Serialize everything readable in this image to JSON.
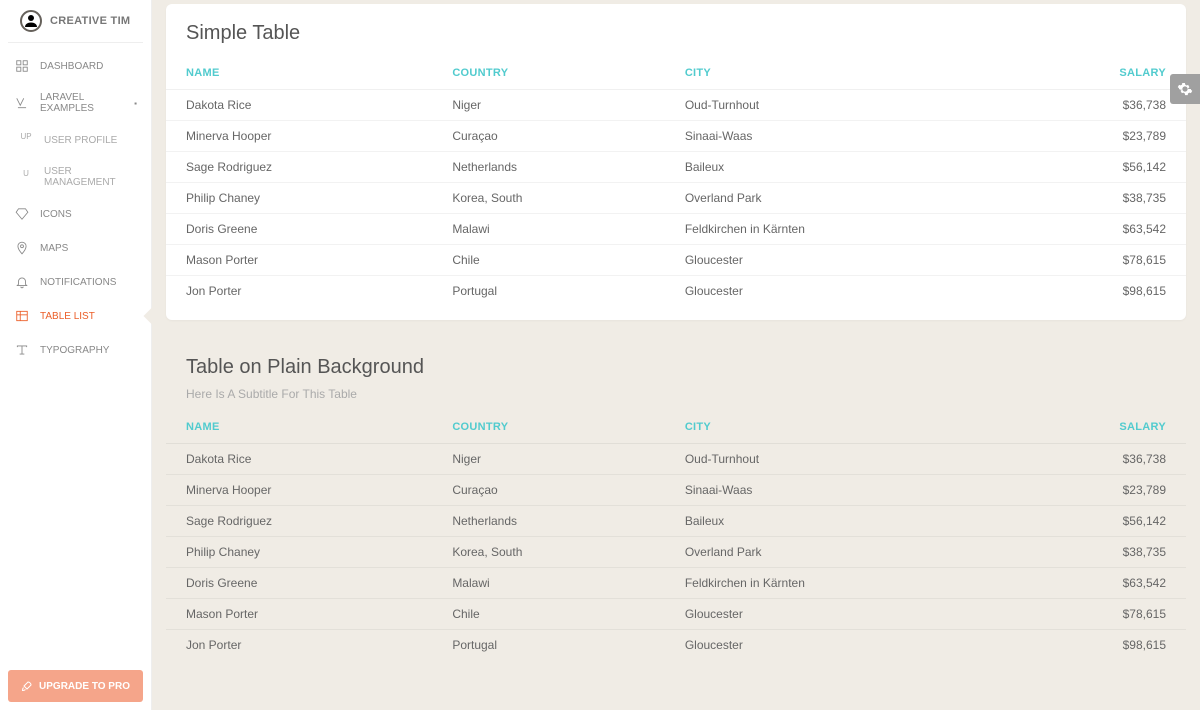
{
  "brand": {
    "name": "CREATIVE TIM"
  },
  "sidebar": {
    "items": [
      {
        "label": "DASHBOARD",
        "icon": "dashboard"
      },
      {
        "label": "LARAVEL EXAMPLES",
        "icon": "laravel",
        "caret": "▪"
      },
      {
        "label": "USER PROFILE",
        "prefix": "UP",
        "sub": true
      },
      {
        "label": "USER MANAGEMENT",
        "prefix": "U",
        "sub": true
      },
      {
        "label": "ICONS",
        "icon": "diamond"
      },
      {
        "label": "MAPS",
        "icon": "pin"
      },
      {
        "label": "NOTIFICATIONS",
        "icon": "bell"
      },
      {
        "label": "TABLE LIST",
        "icon": "table",
        "active": true
      },
      {
        "label": "TYPOGRAPHY",
        "icon": "type"
      }
    ],
    "upgrade": "UPGRADE TO PRO"
  },
  "table1": {
    "title": "Simple Table",
    "headers": [
      "NAME",
      "COUNTRY",
      "CITY",
      "SALARY"
    ],
    "rows": [
      {
        "name": "Dakota Rice",
        "country": "Niger",
        "city": "Oud-Turnhout",
        "salary": "$36,738"
      },
      {
        "name": "Minerva Hooper",
        "country": "Curaçao",
        "city": "Sinaai-Waas",
        "salary": "$23,789"
      },
      {
        "name": "Sage Rodriguez",
        "country": "Netherlands",
        "city": "Baileux",
        "salary": "$56,142"
      },
      {
        "name": "Philip Chaney",
        "country": "Korea, South",
        "city": "Overland Park",
        "salary": "$38,735"
      },
      {
        "name": "Doris Greene",
        "country": "Malawi",
        "city": "Feldkirchen in Kärnten",
        "salary": "$63,542"
      },
      {
        "name": "Mason Porter",
        "country": "Chile",
        "city": "Gloucester",
        "salary": "$78,615"
      },
      {
        "name": "Jon Porter",
        "country": "Portugal",
        "city": "Gloucester",
        "salary": "$98,615"
      }
    ]
  },
  "table2": {
    "title": "Table on Plain Background",
    "subtitle": "Here Is A Subtitle For This Table",
    "headers": [
      "NAME",
      "COUNTRY",
      "CITY",
      "SALARY"
    ],
    "rows": [
      {
        "name": "Dakota Rice",
        "country": "Niger",
        "city": "Oud-Turnhout",
        "salary": "$36,738"
      },
      {
        "name": "Minerva Hooper",
        "country": "Curaçao",
        "city": "Sinaai-Waas",
        "salary": "$23,789"
      },
      {
        "name": "Sage Rodriguez",
        "country": "Netherlands",
        "city": "Baileux",
        "salary": "$56,142"
      },
      {
        "name": "Philip Chaney",
        "country": "Korea, South",
        "city": "Overland Park",
        "salary": "$38,735"
      },
      {
        "name": "Doris Greene",
        "country": "Malawi",
        "city": "Feldkirchen in Kärnten",
        "salary": "$63,542"
      },
      {
        "name": "Mason Porter",
        "country": "Chile",
        "city": "Gloucester",
        "salary": "$78,615"
      },
      {
        "name": "Jon Porter",
        "country": "Portugal",
        "city": "Gloucester",
        "salary": "$98,615"
      }
    ]
  }
}
